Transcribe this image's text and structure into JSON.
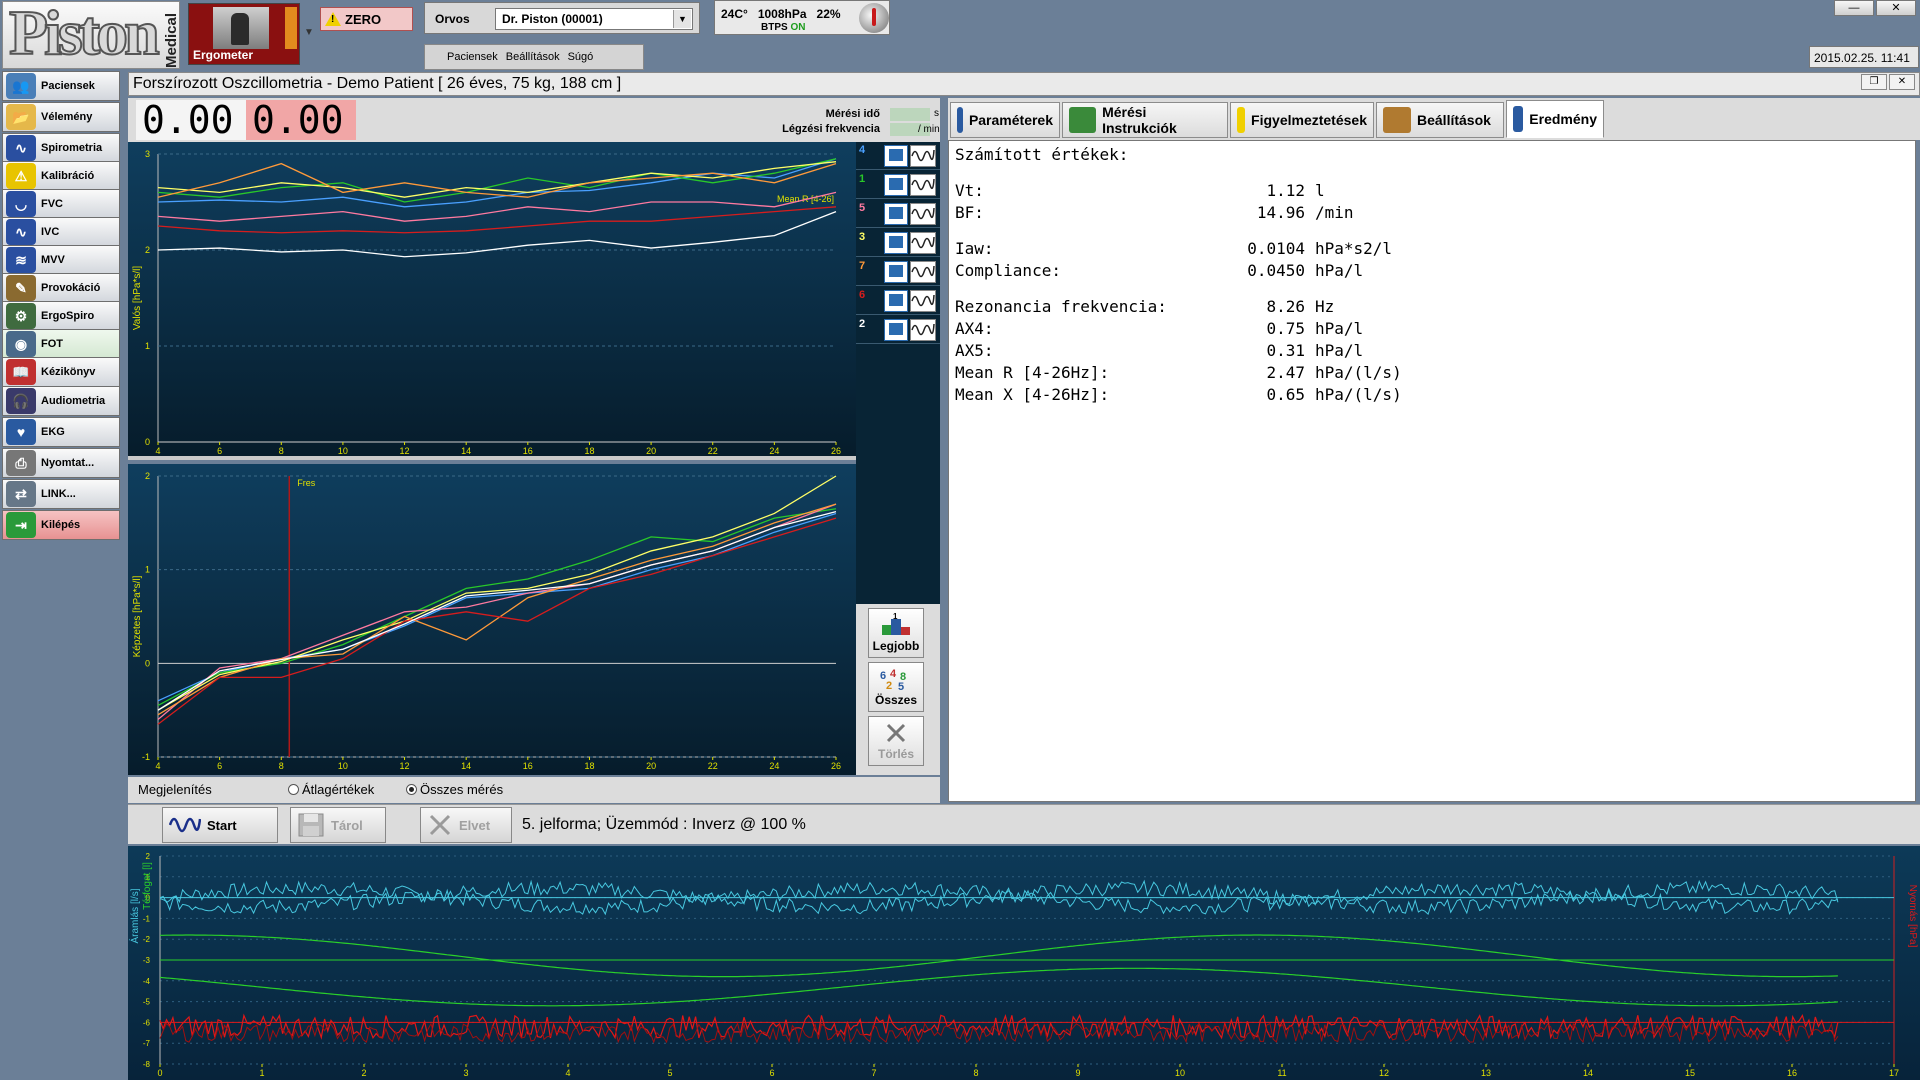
{
  "app": {
    "brand": "Piston",
    "brand_sub": "Medical",
    "module_card": "Ergometer",
    "zero_label": "ZERO"
  },
  "doctor": {
    "label": "Orvos",
    "selected": "Dr. Piston (00001)"
  },
  "menu": [
    "Paciensek",
    "Beállítások",
    "Súgó"
  ],
  "environment": {
    "temp": "24C°",
    "pressure": "1008hPa",
    "humidity": "22%",
    "btps_label": "BTPS",
    "btps_state": "ON"
  },
  "window": {
    "min": "—",
    "close": "✕",
    "restore": "❐"
  },
  "datetime": "2015.02.25. 11:41",
  "sidebar": {
    "items": [
      {
        "label": "Paciensek",
        "icon": "patients-icon",
        "color": "#4a7fb8"
      },
      {
        "label": "Vélemény",
        "icon": "folder-icon",
        "color": "#e5b84a"
      },
      {
        "label": "Spirometria",
        "icon": "wave-icon",
        "color": "#2a4fa0"
      },
      {
        "label": "Kalibráció",
        "icon": "warning-icon",
        "color": "#e8c400"
      },
      {
        "label": "FVC",
        "icon": "fvc-loop-icon",
        "color": "#2a4fa0"
      },
      {
        "label": "IVC",
        "icon": "wave-icon",
        "color": "#2a4fa0"
      },
      {
        "label": "MVV",
        "icon": "mvv-wave-icon",
        "color": "#2a4fa0"
      },
      {
        "label": "Provokáció",
        "icon": "provocation-icon",
        "color": "#8a6a30"
      },
      {
        "label": "ErgoSpiro",
        "icon": "ergospiro-icon",
        "color": "#3f6b3f"
      },
      {
        "label": "FOT",
        "icon": "fot-icon",
        "color": "#4a6a8a"
      },
      {
        "label": "Kézikönyv",
        "icon": "manual-icon",
        "color": "#c03030"
      },
      {
        "label": "Audiometria",
        "icon": "headphones-icon",
        "color": "#3a3a6a"
      },
      {
        "label": "EKG",
        "icon": "ekg-icon",
        "color": "#2a5aa0"
      },
      {
        "label": "Nyomtat...",
        "icon": "printer-icon",
        "color": "#777777"
      },
      {
        "label": "LINK...",
        "icon": "link-icon",
        "color": "#667788"
      },
      {
        "label": "Kilépés",
        "icon": "exit-icon",
        "color": "#2a9a3a"
      }
    ]
  },
  "patient_title": "Forszírozott Oszcillometria  - Demo Patient  [ 26 éves, 75 kg, 188 cm ]",
  "readouts": {
    "value1": "0.00",
    "value2": "0.00",
    "meas_time_label": "Mérési idő",
    "meas_time_unit": "s",
    "resp_freq_label": "Légzési frekvencia",
    "resp_freq_unit": "/ min"
  },
  "chart_data": [
    {
      "type": "line",
      "ylabel": "Valós [hPa*s/l]",
      "x": [
        4,
        6,
        8,
        10,
        12,
        14,
        16,
        18,
        20,
        22,
        24,
        26
      ],
      "ylim": [
        0,
        3
      ],
      "yticks": [
        0,
        1,
        2,
        3
      ],
      "annotation": "Mean R [4-26]",
      "annotation_value": 2.47,
      "series": [
        {
          "color": "#4aa0ff",
          "values": [
            2.5,
            2.52,
            2.5,
            2.55,
            2.45,
            2.5,
            2.6,
            2.62,
            2.7,
            2.8,
            2.75,
            2.95
          ]
        },
        {
          "color": "#29c829",
          "values": [
            2.6,
            2.55,
            2.65,
            2.7,
            2.5,
            2.6,
            2.75,
            2.65,
            2.8,
            2.7,
            2.8,
            2.95
          ]
        },
        {
          "color": "#ff7aa0",
          "values": [
            2.35,
            2.3,
            2.35,
            2.4,
            2.3,
            2.35,
            2.45,
            2.4,
            2.5,
            2.5,
            2.45,
            2.6
          ]
        },
        {
          "color": "#ffff66",
          "values": [
            2.65,
            2.6,
            2.7,
            2.65,
            2.55,
            2.65,
            2.6,
            2.7,
            2.8,
            2.75,
            2.85,
            2.92
          ]
        },
        {
          "color": "#ff9a3a",
          "values": [
            2.55,
            2.7,
            2.9,
            2.6,
            2.7,
            2.6,
            2.55,
            2.7,
            2.75,
            2.8,
            2.7,
            2.9
          ]
        },
        {
          "color": "#d61d1d",
          "values": [
            2.25,
            2.2,
            2.18,
            2.2,
            2.18,
            2.2,
            2.25,
            2.3,
            2.3,
            2.35,
            2.4,
            2.45
          ]
        },
        {
          "color": "#ffffff",
          "values": [
            2.0,
            2.02,
            1.98,
            2.0,
            1.93,
            1.97,
            2.05,
            2.1,
            2.02,
            2.08,
            2.15,
            2.4
          ]
        }
      ]
    },
    {
      "type": "line",
      "ylabel": "Képzetes [hPa*s/l]",
      "x": [
        4,
        6,
        8,
        10,
        12,
        14,
        16,
        18,
        20,
        22,
        24,
        26
      ],
      "ylim": [
        -1,
        2
      ],
      "yticks": [
        -1,
        0,
        1,
        2
      ],
      "annotation": "Fres",
      "annotation_x": 8.26,
      "series": [
        {
          "color": "#4aa0ff",
          "values": [
            -0.4,
            -0.1,
            0.05,
            0.15,
            0.4,
            0.7,
            0.75,
            0.8,
            1.0,
            1.15,
            1.4,
            1.6
          ]
        },
        {
          "color": "#29c829",
          "values": [
            -0.45,
            -0.1,
            0.0,
            0.2,
            0.5,
            0.8,
            0.9,
            1.1,
            1.35,
            1.3,
            1.55,
            1.65
          ]
        },
        {
          "color": "#ff7aa0",
          "values": [
            -0.6,
            -0.05,
            0.05,
            0.3,
            0.55,
            0.6,
            0.75,
            0.85,
            1.05,
            1.2,
            1.45,
            1.7
          ]
        },
        {
          "color": "#ffff66",
          "values": [
            -0.5,
            -0.12,
            0.02,
            0.25,
            0.45,
            0.75,
            0.8,
            0.95,
            1.2,
            1.35,
            1.6,
            2.0
          ]
        },
        {
          "color": "#ff9a3a",
          "values": [
            -0.55,
            -0.15,
            0.05,
            0.1,
            0.5,
            0.25,
            0.7,
            0.9,
            1.1,
            1.25,
            1.5,
            1.7
          ]
        },
        {
          "color": "#d61d1d",
          "values": [
            -0.65,
            -0.15,
            -0.15,
            0.05,
            0.45,
            0.55,
            0.45,
            0.8,
            0.95,
            1.15,
            1.35,
            1.55
          ]
        },
        {
          "color": "#ffffff",
          "values": [
            -0.5,
            -0.08,
            0.04,
            0.15,
            0.42,
            0.72,
            0.78,
            0.85,
            1.05,
            1.2,
            1.45,
            1.62
          ]
        }
      ]
    }
  ],
  "measurements": [
    {
      "num": "4",
      "color": "#4aa0ff"
    },
    {
      "num": "1",
      "color": "#29c829"
    },
    {
      "num": "5",
      "color": "#ff7aa0"
    },
    {
      "num": "3",
      "color": "#ffff66"
    },
    {
      "num": "7",
      "color": "#ff9a3a"
    },
    {
      "num": "6",
      "color": "#d61d1d"
    },
    {
      "num": "2",
      "color": "#ffffff"
    }
  ],
  "tools": {
    "best": "Legjobb",
    "all": "Összes",
    "delete": "Törlés"
  },
  "display": {
    "label": "Megjelenítés",
    "opt_avg": "Átlagértékek",
    "opt_all": "Összes mérés",
    "selected": "Összes mérés"
  },
  "tabs": [
    {
      "label": "Paraméterek",
      "icon": "parameters-icon"
    },
    {
      "label": "Mérési Instrukciók",
      "icon": "instructions-icon"
    },
    {
      "label": "Figyelmeztetések",
      "icon": "warning-icon"
    },
    {
      "label": "Beállítások",
      "icon": "settings-icon"
    },
    {
      "label": "Eredmény",
      "icon": "results-table-icon",
      "active": true
    }
  ],
  "results": {
    "header": "Számított értékek:",
    "rows": [
      {
        "label": "Vt:",
        "value": "1.12",
        "unit": "l"
      },
      {
        "label": "BF:",
        "value": "14.96",
        "unit": "/min"
      },
      {
        "label": "Iaw:",
        "value": "0.0104",
        "unit": "hPa*s2/l"
      },
      {
        "label": "Compliance:",
        "value": "0.0450",
        "unit": "hPa/l"
      },
      {
        "label": "Rezonancia frekvencia:",
        "value": "8.26",
        "unit": "Hz"
      },
      {
        "label": "AX4:",
        "value": "0.75",
        "unit": "hPa/l"
      },
      {
        "label": "AX5:",
        "value": "0.31",
        "unit": "hPa/l"
      },
      {
        "label": "Mean R [4-26Hz]:",
        "value": "2.47",
        "unit": "hPa/(l/s)"
      },
      {
        "label": "Mean X [4-26Hz]:",
        "value": "0.65",
        "unit": "hPa/(l/s)"
      }
    ]
  },
  "actions": {
    "start": "Start",
    "store": "Tárol",
    "reject": "Elvet",
    "status": "5. jelforma;  Üzemmód :  Inverz  @ 100 %"
  },
  "signal": {
    "left_label1": "Áramlás [l/s]",
    "left_label2": "Térfogat [l]",
    "right_label": "Nyomás [hPa]",
    "x_ticks": [
      0,
      1,
      2,
      3,
      4,
      5,
      6,
      7,
      8,
      9,
      10,
      11,
      12,
      13,
      14,
      15,
      16,
      17
    ],
    "y_ticks": [
      2,
      1,
      0,
      -1,
      -2,
      -3,
      -4,
      -5,
      -6,
      -7,
      -8
    ],
    "flow_color": "#48c8e0",
    "volume_color": "#2ad02a",
    "pressure_color": "#e01818"
  }
}
